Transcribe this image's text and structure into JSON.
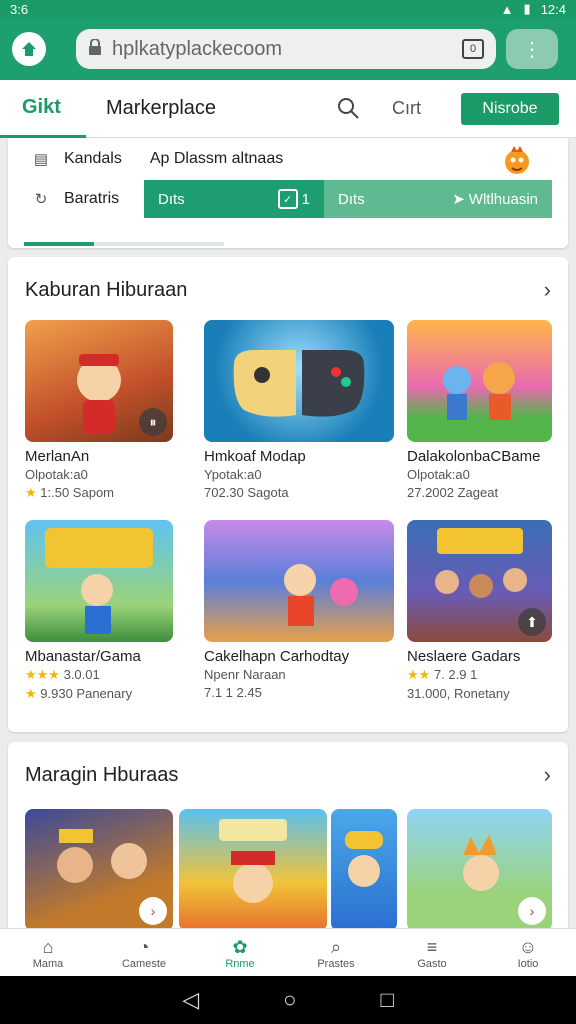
{
  "status": {
    "time": "3:6",
    "clock": "12:4"
  },
  "browser": {
    "url": "hplkatyplackecoom",
    "tabs_count": "0"
  },
  "header": {
    "logo": "Gikt",
    "title": "Markerplace",
    "link": "Cırt",
    "cta": "Nisrobe"
  },
  "filters": {
    "row1_label": "Kandals",
    "row1_value": "Ap Dlassm altnaas",
    "row2_label": "Baratris",
    "seg1_label": "Dıts",
    "seg1_count": "1",
    "seg2_label": "Dıts",
    "seg2_action": "Wltlhuasin",
    "progress": 0.35
  },
  "sections": [
    {
      "title": "Kaburan Hiburaan",
      "items": [
        {
          "name": "MerlanAn",
          "sub": "Olpotak:a0",
          "meta": "1:.50 Sapom",
          "stars": "★",
          "badge": "⏸"
        },
        {
          "name": "Hmkoaf Modap",
          "sub": "Ypotak:a0",
          "meta": "702.30 Sagota",
          "stars": "",
          "badge": ""
        },
        {
          "name": "DalakolonbaCBame",
          "sub": "Olpotak:a0",
          "meta": "27.2002 Zageat",
          "stars": "",
          "badge": ""
        },
        {
          "name": "Mbanastar/Gama",
          "sub": "3.0.01",
          "meta": "9.930 Panenary",
          "stars": "★★★",
          "stars2": "★",
          "badge": ""
        },
        {
          "name": "Cakelhapn Carhodtay",
          "sub": "Npenr Naraan",
          "meta": "7.1 1 2.45",
          "stars": "",
          "badge": ""
        },
        {
          "name": "Neslaere Gadars",
          "sub": "7. 2.9 1",
          "meta": "31.000, Ronetany",
          "stars": "★★",
          "badge": "⬆"
        }
      ]
    },
    {
      "title": "Maragin Hburaas",
      "items": []
    }
  ],
  "nav": [
    {
      "label": "Mama",
      "icon": "⌂"
    },
    {
      "label": "Cameste",
      "icon": "◔"
    },
    {
      "label": "Rnme",
      "icon": "✿"
    },
    {
      "label": "Prastes",
      "icon": "⌕"
    },
    {
      "label": "Gasto",
      "icon": "≡"
    },
    {
      "label": "Iotio",
      "icon": "☺"
    }
  ],
  "colors": {
    "brand": "#1b9b67",
    "accent_light": "#5fba91",
    "star": "#f2b705"
  }
}
